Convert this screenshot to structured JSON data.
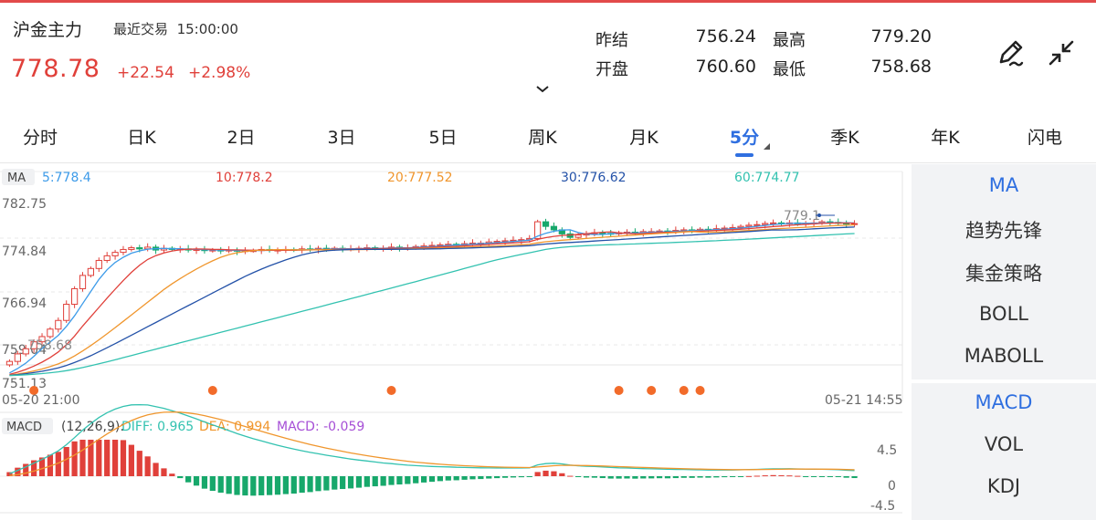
{
  "header": {
    "title": "沪金主力",
    "trade_status": "最近交易",
    "trade_time": "15:00:00",
    "price": "778.78",
    "change": "+22.54",
    "change_pct": "+2.98%"
  },
  "quote": {
    "prev_close_label": "昨结",
    "prev_close": "756.24",
    "high_label": "最高",
    "high": "779.20",
    "open_label": "开盘",
    "open": "760.60",
    "low_label": "最低",
    "low": "758.68"
  },
  "tabs": [
    "分时",
    "日K",
    "2日",
    "3日",
    "5日",
    "周K",
    "月K",
    "5分",
    "季K",
    "年K",
    "闪电"
  ],
  "active_tab": "5分",
  "ma_legend": {
    "label": "MA",
    "ma5": "5:778.4",
    "ma10": "10:778.2",
    "ma20": "20:777.52",
    "ma30": "30:776.62",
    "ma60": "60:774.77"
  },
  "price_axis": [
    "782.75",
    "774.84",
    "766.94",
    "759.04",
    "751.13"
  ],
  "low_mark": "758.68",
  "high_mark": "779.1",
  "time_axis": {
    "start": "05-20 21:00",
    "end": "05-21 14:55"
  },
  "macd_legend": {
    "label": "MACD",
    "params": "(12,26,9):",
    "diff": "DIFF: 0.965",
    "dea": "DEA: 0.994",
    "macd": "MACD: -0.059"
  },
  "macd_axis": [
    "4.5",
    "0",
    "-4.5"
  ],
  "sidebar": {
    "main_indicators": [
      "MA",
      "趋势先锋",
      "集金策略",
      "BOLL",
      "MABOLL"
    ],
    "sub_indicators": [
      "MACD",
      "VOL",
      "KDJ"
    ],
    "active_main": "MA",
    "active_sub": "MACD"
  },
  "colors": {
    "up": "#e0403a",
    "down": "#17a86b",
    "ma5": "#3d9be9",
    "ma10": "#e0403a",
    "ma20": "#f0962d",
    "ma30": "#2452a8",
    "ma60": "#33c2b0",
    "diff": "#33c2b0",
    "dea": "#f0962d",
    "macd": "#a64fd6",
    "accent": "#2f6fe0",
    "signal_dot": "#f26b2a"
  },
  "chart_data": {
    "type": "candlestick",
    "interval": "5分",
    "ylim": [
      751.13,
      782.75
    ],
    "candles_close": [
      754.9,
      756.2,
      757.1,
      758.3,
      759.2,
      760.5,
      762.0,
      764.8,
      767.5,
      769.8,
      771.0,
      772.4,
      773.2,
      773.8,
      774.3,
      774.6,
      774.4,
      774.7,
      774.2,
      774.5,
      774.3,
      774.4,
      774.2,
      774.3,
      774.1,
      774.2,
      774.1,
      774.2,
      774.0,
      774.1,
      774.1,
      774.3,
      774.2,
      774.2,
      774.3,
      774.2,
      774.4,
      774.3,
      774.5,
      774.4,
      774.5,
      774.4,
      774.4,
      774.5,
      774.6,
      774.5,
      774.5,
      774.7,
      774.6,
      774.6,
      774.8,
      774.9,
      775.0,
      775.1,
      775.2,
      775.1,
      775.3,
      775.4,
      775.4,
      775.6,
      775.7,
      775.8,
      775.9,
      776.0,
      776.2,
      779.1,
      778.3,
      777.7,
      777.0,
      776.4,
      776.8,
      777.0,
      777.2,
      777.1,
      777.0,
      777.2,
      777.3,
      777.2,
      777.4,
      777.4,
      777.5,
      777.4,
      777.6,
      777.7,
      777.6,
      777.8,
      777.7,
      777.9,
      778.0,
      778.1,
      778.3,
      778.5,
      778.6,
      778.8,
      778.9,
      778.8,
      778.9,
      778.8,
      778.8,
      778.9,
      779.1,
      779.0,
      778.9,
      778.7,
      778.78
    ],
    "ma5_last": 778.4,
    "ma10_last": 778.2,
    "ma20_last": 777.52,
    "ma30_last": 776.62,
    "ma60_last": 774.77,
    "signal_dots_x": [
      3,
      25,
      47,
      75,
      79,
      83,
      85
    ],
    "macd_ylim": [
      -4.5,
      4.5
    ],
    "macd_last": {
      "diff": 0.965,
      "dea": 0.994,
      "macd": -0.059
    }
  }
}
